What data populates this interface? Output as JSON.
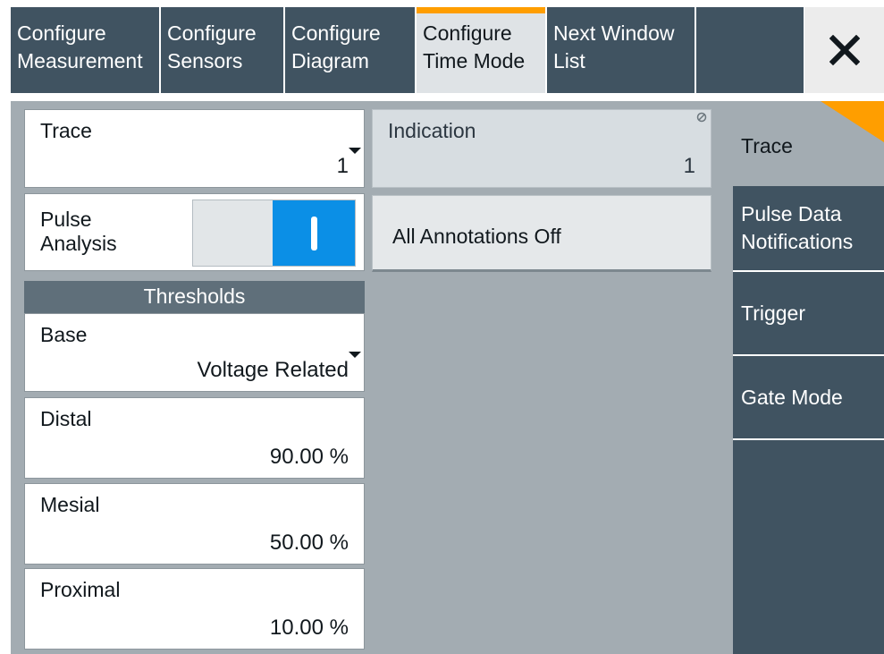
{
  "top_tabs": [
    {
      "line1": "Configure",
      "line2": "Measurement"
    },
    {
      "line1": "Configure",
      "line2": "Sensors"
    },
    {
      "line1": "Configure",
      "line2": "Diagram"
    },
    {
      "line1": "Configure",
      "line2": "Time Mode"
    },
    {
      "line1": "Next Window",
      "line2": "List"
    }
  ],
  "active_tab": "Configure Time Mode",
  "close_icon": "close-icon",
  "form": {
    "trace": {
      "label": "Trace",
      "value": "1"
    },
    "indication": {
      "label": "Indication",
      "value": "1"
    },
    "pulse_analysis": {
      "label_line1": "Pulse",
      "label_line2": "Analysis",
      "state": "on"
    },
    "all_annotations_off": "All Annotations Off",
    "thresholds_header": "Thresholds",
    "base": {
      "label": "Base",
      "value": "Voltage Related"
    },
    "distal": {
      "label": "Distal",
      "value": "90.00 %"
    },
    "mesial": {
      "label": "Mesial",
      "value": "50.00 %"
    },
    "proximal": {
      "label": "Proximal",
      "value": "10.00 %"
    }
  },
  "side_tabs": [
    {
      "line1": "Trace"
    },
    {
      "line1": "Pulse Data",
      "line2": "Notifications"
    },
    {
      "line1": "Trigger"
    },
    {
      "line1": "Gate Mode"
    }
  ],
  "colors": {
    "accent": "#ff9e00",
    "toggle_on": "#0b8fe6",
    "tab_background": "#405361",
    "panel_background": "#a3acb2"
  }
}
